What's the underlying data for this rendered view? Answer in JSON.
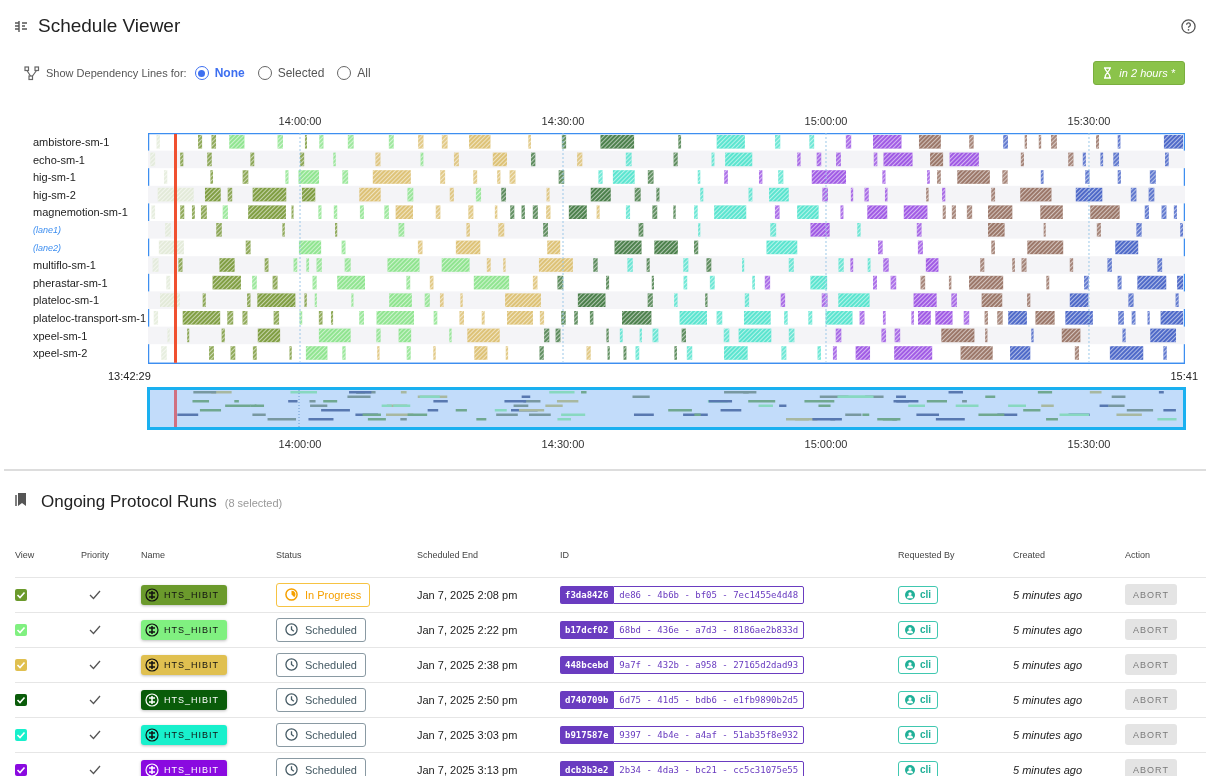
{
  "header": {
    "title": "Schedule Viewer"
  },
  "dependency_lines": {
    "label": "Show Dependency Lines for:",
    "options": [
      {
        "label": "None",
        "selected": true
      },
      {
        "label": "Selected",
        "selected": false
      },
      {
        "label": "All",
        "selected": false
      }
    ]
  },
  "timer_button": {
    "label": "in 2 hours *"
  },
  "schedule": {
    "top_ticks": [
      "14:00:00",
      "14:30:00",
      "15:00:00",
      "15:30:00"
    ],
    "lanes": [
      {
        "label": "ambistore-sm-1",
        "kind": "device"
      },
      {
        "label": "echo-sm-1",
        "kind": "device"
      },
      {
        "label": "hig-sm-1",
        "kind": "device"
      },
      {
        "label": "hig-sm-2",
        "kind": "device"
      },
      {
        "label": "magnemotion-sm-1",
        "kind": "device"
      },
      {
        "label": "(lane1)",
        "kind": "sublane"
      },
      {
        "label": "(lane2)",
        "kind": "sublane"
      },
      {
        "label": "multiflo-sm-1",
        "kind": "device"
      },
      {
        "label": "pherastar-sm-1",
        "kind": "device"
      },
      {
        "label": "plateloc-sm-1",
        "kind": "device"
      },
      {
        "label": "plateloc-transport-sm-1",
        "kind": "device"
      },
      {
        "label": "xpeel-sm-1",
        "kind": "device"
      },
      {
        "label": "xpeel-sm-2",
        "kind": "device"
      }
    ],
    "range_start": "13:42:29",
    "range_end": "15:41",
    "bottom_ticks": [
      "14:00:00",
      "14:30:00",
      "15:00:00",
      "15:30:00"
    ]
  },
  "runs": {
    "title": "Ongoing Protocol Runs",
    "selected_count": "(8 selected)",
    "columns": [
      "View",
      "Priority",
      "Name",
      "Status",
      "Scheduled End",
      "ID",
      "Requested By",
      "Created",
      "Action"
    ],
    "rows": [
      {
        "checked": true,
        "color": "#6b9a2c",
        "name": "HTS_HIBIT",
        "status": {
          "kind": "in_progress",
          "label": "In Progress"
        },
        "scheduled_end": "Jan 7, 2025 2:08 pm",
        "id_prefix": "f3da8426",
        "id_rest": "de86 - 4b6b - bf05 - 7ec1455e4d48",
        "requested_by": "cli",
        "created": "5 minutes ago",
        "action": {
          "label": "ABORT",
          "disabled": true
        }
      },
      {
        "checked": true,
        "color": "#80f080",
        "name": "HTS_HIBIT",
        "status": {
          "kind": "scheduled",
          "label": "Scheduled"
        },
        "scheduled_end": "Jan 7, 2025 2:22 pm",
        "id_prefix": "b17dcf02",
        "id_rest": "68bd - 436e - a7d3 - 8186ae2b833d",
        "requested_by": "cli",
        "created": "5 minutes ago",
        "action": {
          "label": "ABORT",
          "disabled": true
        }
      },
      {
        "checked": true,
        "color": "#e0c050",
        "name": "HTS_HIBIT",
        "status": {
          "kind": "scheduled",
          "label": "Scheduled"
        },
        "scheduled_end": "Jan 7, 2025 2:38 pm",
        "id_prefix": "448bcebd",
        "id_rest": "9a7f - 432b - a958 - 27165d2dad93",
        "requested_by": "cli",
        "created": "5 minutes ago",
        "action": {
          "label": "ABORT",
          "disabled": true
        }
      },
      {
        "checked": true,
        "color": "#0a5c0a",
        "name": "HTS_HIBIT",
        "status": {
          "kind": "scheduled",
          "label": "Scheduled"
        },
        "scheduled_end": "Jan 7, 2025 2:50 pm",
        "id_prefix": "d740709b",
        "id_rest": "6d75 - 41d5 - bdb6 - e1fb9890b2d5",
        "requested_by": "cli",
        "created": "5 minutes ago",
        "action": {
          "label": "ABORT",
          "disabled": true
        }
      },
      {
        "checked": true,
        "color": "#18f0cc",
        "name": "HTS_HIBIT",
        "status": {
          "kind": "scheduled",
          "label": "Scheduled"
        },
        "scheduled_end": "Jan 7, 2025 3:03 pm",
        "id_prefix": "b917587e",
        "id_rest": "9397 - 4b4e - a4af - 51ab35f8e932",
        "requested_by": "cli",
        "created": "5 minutes ago",
        "action": {
          "label": "ABORT",
          "disabled": true
        }
      },
      {
        "checked": true,
        "color": "#8a0ae0",
        "name": "HTS_HIBIT",
        "status": {
          "kind": "scheduled",
          "label": "Scheduled"
        },
        "scheduled_end": "Jan 7, 2025 3:13 pm",
        "id_prefix": "dcb3b3e2",
        "id_rest": "2b34 - 4da3 - bc21 - cc5c31075e55",
        "requested_by": "cli",
        "created": "5 minutes ago",
        "action": {
          "label": "ABORT",
          "disabled": true
        }
      }
    ]
  }
}
